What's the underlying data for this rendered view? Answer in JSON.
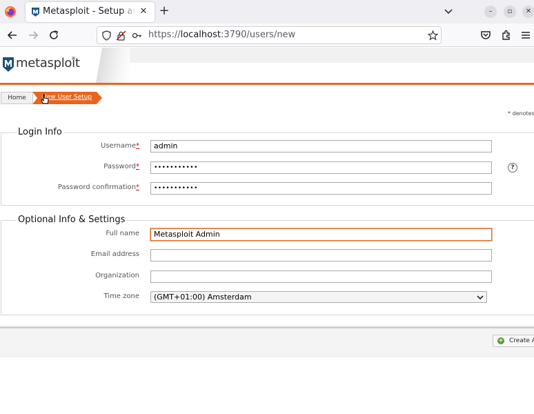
{
  "browser": {
    "tab_title": "Metasploit - Setup and Configuration",
    "tab_close": "✕",
    "new_tab": "+",
    "url_scheme": "https://",
    "url_host": "localhost",
    "url_rest": ":3790/users/new",
    "win_minimize": "–",
    "win_restore": "▫",
    "win_close": "✕"
  },
  "header": {
    "logo_text": "metasploit",
    "logo_reg": "®"
  },
  "breadcrumb": {
    "home": "Home",
    "current": "New User Setup"
  },
  "denotes_text": "* denotes",
  "login_info": {
    "legend": "Login Info",
    "username_label": "Username",
    "username_value": "admin",
    "password_label": "Password",
    "password_value": "•••••••••••",
    "password_confirm_label": "Password confirmation",
    "password_confirm_value": "•••••••••••",
    "required_mark": "*",
    "help": "?"
  },
  "optional": {
    "legend": "Optional Info & Settings",
    "fullname_label": "Full name",
    "fullname_value": "Metasploit Admin",
    "email_label": "Email address",
    "email_value": "",
    "organization_label": "Organization",
    "organization_value": "",
    "timezone_label": "Time zone",
    "timezone_value": "(GMT+01:00) Amsterdam"
  },
  "actions": {
    "create_label": "Create Account"
  },
  "colors": {
    "accent": "#e7661f",
    "browser_bg": "#efeef2"
  }
}
